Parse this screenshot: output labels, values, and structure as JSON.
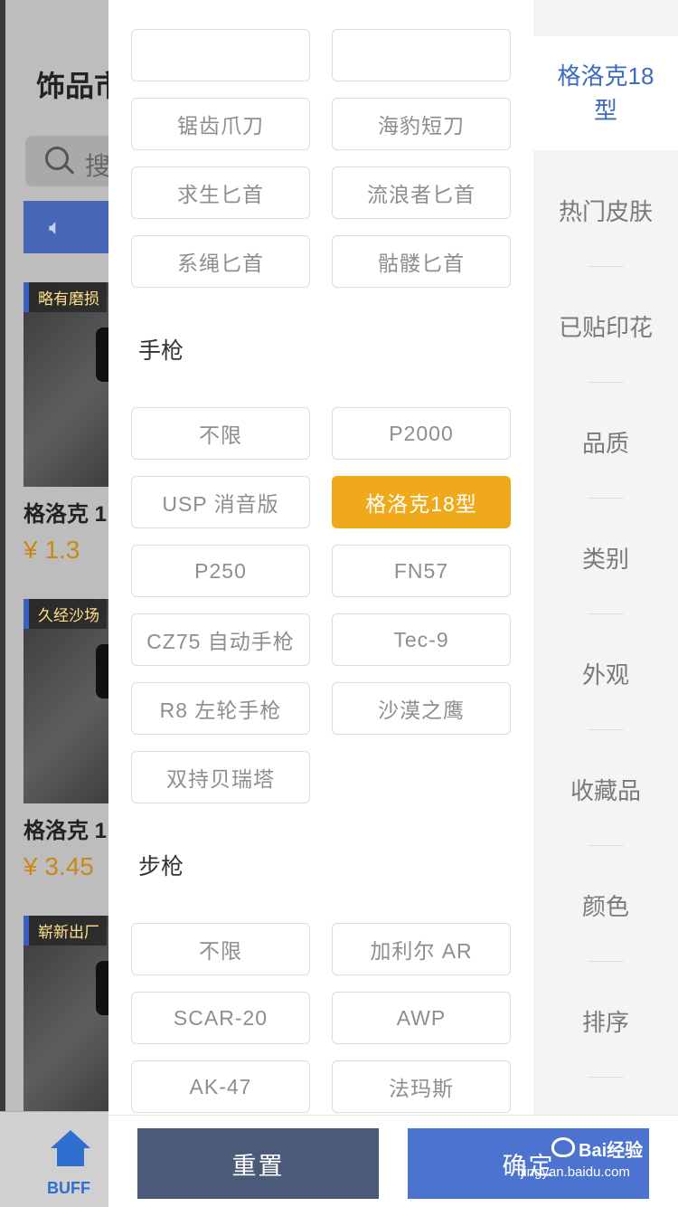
{
  "background": {
    "title": "饰品市",
    "search_placeholder": "搜",
    "cards": [
      {
        "tag": "略有磨损",
        "name": "格洛克 1",
        "price": "¥ 1.3"
      },
      {
        "tag": "久经沙场",
        "name": "格洛克 1",
        "price": "¥ 3.45"
      },
      {
        "tag": "崭新出厂"
      }
    ],
    "tab_label": "BUFF"
  },
  "filter": {
    "knife_buttons": [
      "",
      "",
      "锯齿爪刀",
      "海豹短刀",
      "求生匕首",
      "流浪者匕首",
      "系绳匕首",
      "骷髅匕首"
    ],
    "pistol_title": "手枪",
    "pistol_buttons": [
      "不限",
      "P2000",
      "USP 消音版",
      "格洛克18型",
      "P250",
      "FN57",
      "CZ75 自动手枪",
      "Tec-9",
      "R8 左轮手枪",
      "沙漠之鹰",
      "双持贝瑞塔"
    ],
    "pistol_selected": "格洛克18型",
    "rifle_title": "步枪",
    "rifle_buttons": [
      "不限",
      "加利尔 AR",
      "SCAR-20",
      "AWP",
      "AK-47",
      "法玛斯"
    ]
  },
  "sidenav": {
    "active": "格洛克18型",
    "items": [
      "热门皮肤",
      "已贴印花",
      "品质",
      "类别",
      "外观",
      "收藏品",
      "颜色",
      "排序"
    ]
  },
  "actions": {
    "reset_label": "重置",
    "confirm_label": "确定"
  },
  "watermark": {
    "brand": "Bai经验",
    "url": "jingyan.baidu.com"
  },
  "colors": {
    "selected": "#f0a91b",
    "accent_blue": "#3e6bbf",
    "reset": "#4b5a78",
    "confirm": "#4c73d0"
  }
}
